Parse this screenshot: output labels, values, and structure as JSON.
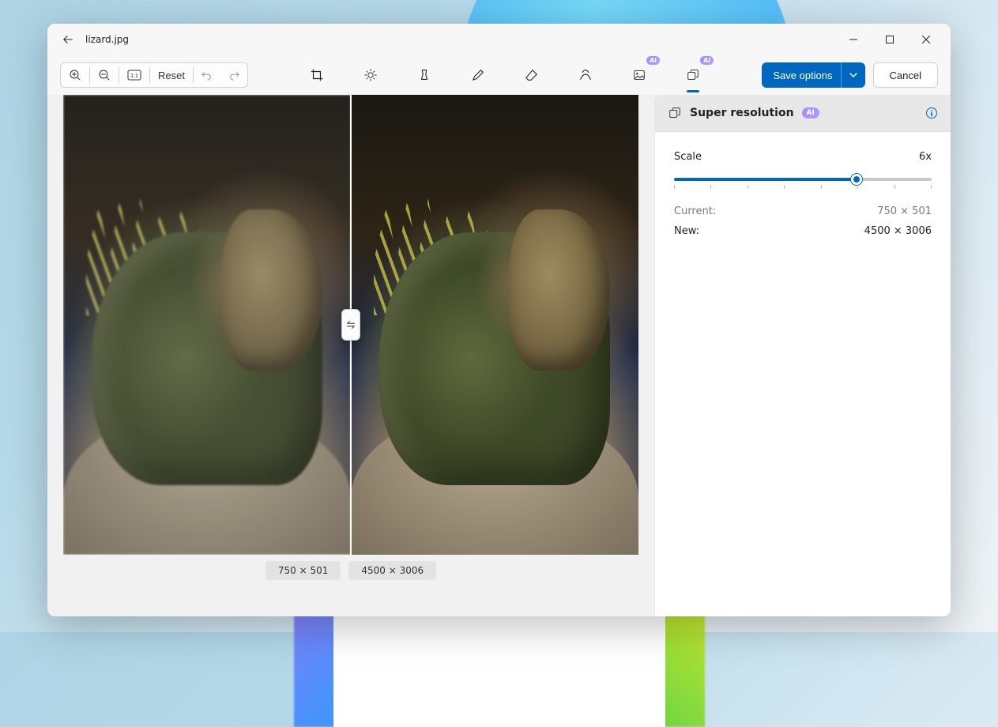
{
  "titlebar": {
    "filename": "lizard.jpg"
  },
  "toolbar": {
    "reset_label": "Reset",
    "save_label": "Save options",
    "cancel_label": "Cancel",
    "ai_badge": "AI"
  },
  "compare": {
    "left_label": "750 × 501",
    "right_label": "4500 × 3006"
  },
  "panel": {
    "title": "Super resolution",
    "ai_badge": "AI",
    "scale_label": "Scale",
    "scale_value": "6x",
    "slider_percent": 71,
    "ticks": 8,
    "current_label": "Current:",
    "current_value": "750 × 501",
    "new_label": "New:",
    "new_value": "4500 × 3006"
  }
}
